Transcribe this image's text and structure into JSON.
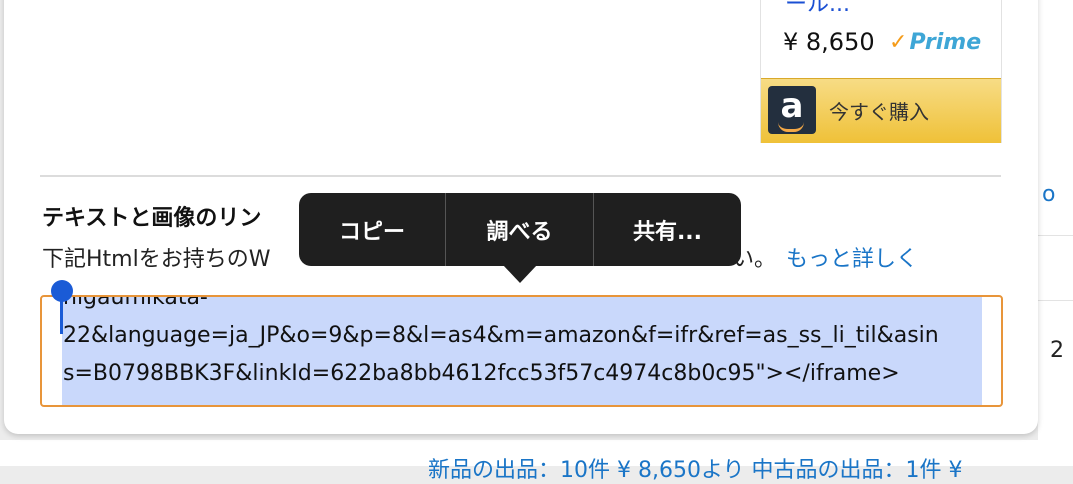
{
  "product": {
    "title_fragment": "ール...",
    "price": "¥ 8,650",
    "prime_label": "Prime",
    "buy_label": "今すぐ購入"
  },
  "section": {
    "heading": "テキストと画像のリン",
    "description": "下記Htmlをお持ちのW",
    "description_tail": "い。",
    "more_link": "もっと詳しく"
  },
  "code": {
    "lines": [
      "nigaumikata-",
      "22&language=ja_JP&o=9&p=8&l=as4&m=amazon&f=ifr&ref=as_ss_li_til&asin",
      "s=B0798BBK3F&linkId=622ba8bb4612fcc53f57c4974c8b0c95\"></iframe>"
    ]
  },
  "context_menu": {
    "items": [
      "コピー",
      "調べる",
      "共有..."
    ]
  },
  "background": {
    "right_link_fragment": "o",
    "right_number_fragment": "2",
    "bottom_text_fragment": "新品の出品：10件 ¥ 8,650より 中古品の出品：1件 ¥"
  },
  "colors": {
    "link": "#1a75c7",
    "selection": "#c9d8fb",
    "focus_border": "#e8953a",
    "menu_bg": "#1f1f1f",
    "buy_button": "#efc138"
  }
}
